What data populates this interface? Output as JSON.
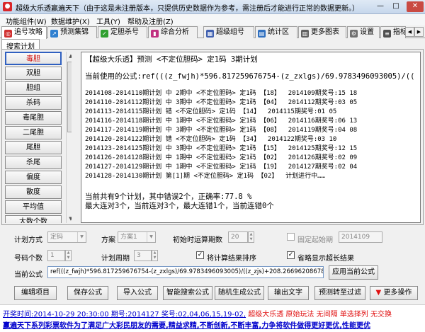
{
  "window": {
    "title": "超级大乐透赢遍天下（由于这是未注册版本，只提供历史数据作为参考，需注册后才能进行正常的数据更新。）",
    "minimize": "—",
    "maximize": "□",
    "close": "✕"
  },
  "menu": [
    "功能组件(W)",
    "数据维护(X)",
    "工具(Y)",
    "帮助及注册(Z)"
  ],
  "tabs": [
    {
      "label": "追号攻略",
      "icon": "target-icon",
      "color": "#d03030"
    },
    {
      "label": "预测集锦",
      "icon": "chart-icon",
      "color": "#3080d0"
    },
    {
      "label": "定胆杀号",
      "icon": "check-icon",
      "color": "#30a030"
    },
    {
      "label": "综合分析",
      "icon": "bars-icon",
      "color": "#c03080"
    },
    {
      "label": "超级组号",
      "icon": "grid-icon",
      "color": "#4060b0"
    },
    {
      "label": "统计区",
      "icon": "stats-icon",
      "color": "#3070c0"
    },
    {
      "label": "更多图表",
      "icon": "graph-icon",
      "color": "#606060"
    },
    {
      "label": "设置",
      "icon": "settings-icon",
      "color": "#707070"
    },
    {
      "label": "指标",
      "icon": "index-icon",
      "color": "#505050"
    }
  ],
  "subtab": "搜索计划",
  "left_list": {
    "items": [
      "毒胆",
      "双胆",
      "胆组",
      "杀码",
      "毒尾胆",
      "二尾胆",
      "尾胆",
      "杀尾",
      "偏度",
      "散度",
      "平均值",
      "大数个数",
      "奇数个数"
    ],
    "selected_index": 0
  },
  "text_panel": {
    "header": "【超级大乐透】预测 <不定位胆码> 定1码 3期计划",
    "formula_line": "当前使用的公式:ref(((z_fwjh)*596.817259676754-(z_zxlgs)/69.9783496093005)/((",
    "rows": [
      {
        "range": "2014108-2014110",
        "plan": "期计划",
        "mid": "中 2期中",
        "pred": "<不定位胆码> 定1码",
        "code": "【18】",
        "issue": "2014109期奖号:15 18"
      },
      {
        "range": "2014110-2014112",
        "plan": "期计划",
        "mid": "中 3期中",
        "pred": "<不定位胆码> 定1码",
        "code": "【04】",
        "issue": "2014112期奖号:03 05"
      },
      {
        "range": "2014113-2014115",
        "plan": "期计划",
        "mid": "错",
        "pred": "<不定位胆码> 定1码",
        "code": "【14】",
        "issue": "2014115期奖号:01 05"
      },
      {
        "range": "2014116-2014118",
        "plan": "期计划",
        "mid": "中 1期中",
        "pred": "<不定位胆码> 定1码",
        "code": "【06】",
        "issue": "2014116期奖号:06 13"
      },
      {
        "range": "2014117-2014119",
        "plan": "期计划",
        "mid": "中 3期中",
        "pred": "<不定位胆码> 定1码",
        "code": "【08】",
        "issue": "2014119期奖号:04 08"
      },
      {
        "range": "2014120-2014122",
        "plan": "期计划",
        "mid": "错",
        "pred": "<不定位胆码> 定1码",
        "code": "【34】",
        "issue": "2014122期奖号:03 10"
      },
      {
        "range": "2014123-2014125",
        "plan": "期计划",
        "mid": "中 3期中",
        "pred": "<不定位胆码> 定1码",
        "code": "【15】",
        "issue": "2014125期奖号:12 15"
      },
      {
        "range": "2014126-2014128",
        "plan": "期计划",
        "mid": "中 1期中",
        "pred": "<不定位胆码> 定1码",
        "code": "【02】",
        "issue": "2014126期奖号:02 09"
      },
      {
        "range": "2014127-2014129",
        "plan": "期计划",
        "mid": "中 1期中",
        "pred": "<不定位胆码> 定1码",
        "code": "【19】",
        "issue": "2014127期奖号:02 04"
      },
      {
        "range": "2014128-2014130",
        "plan": "期计划",
        "mid": "第[1]期",
        "pred": "<不定位胆码> 定1码",
        "code": "【02】",
        "issue": "计划进行中……"
      }
    ],
    "summary1": "当前共有9个计划，其中错误2个，正确率:77.8 %",
    "summary2": "最大连对3个，当前连对3个，最大连错1个，当前连错0个"
  },
  "form": {
    "plan_mode_label": "计划方式",
    "plan_mode_value": "定码",
    "scheme_label": "方案",
    "scheme_value": "方案1",
    "init_periods_label": "初始时运算期数",
    "init_periods_value": "20",
    "fixed_start_label": "固定起始期",
    "fixed_start_value": "2014109",
    "code_count_label": "号码个数",
    "code_count_value": "1",
    "plan_cycle_label": "计划周期",
    "plan_cycle_value": "3",
    "sort_label": "将计算结果排序",
    "omit_label": "省略显示超长结果",
    "formula_label": "当前公式",
    "formula_value": "ref(((z_fwjh)*596.817259676754-(z_zxlgs)/69.9783496093005)/((z_zjs)+208.266962086782),1)$ref(((z_1lhe)",
    "apply_btn": "应用当前公式",
    "buttons": [
      "编辑项目",
      "保存公式",
      "导入公式",
      "智能搜索公式",
      "随机生成公式",
      "输出文字",
      "预测转至过滤",
      "更多操作"
    ]
  },
  "status": {
    "line1_prefix": "开奖时间:2014-10-29 20:30:00 期号:2014127 奖号:02,04,06,15,19-02,",
    "line1_suffix": "超级大乐透  原始玩法  无间隔  单选择列  无交换",
    "line2": "赢遍天下系列彩票软件为了满足广大彩民朋友的需要,精益求精,不断创新,不断丰富,力争将软件做得更好更优,性能更优"
  }
}
